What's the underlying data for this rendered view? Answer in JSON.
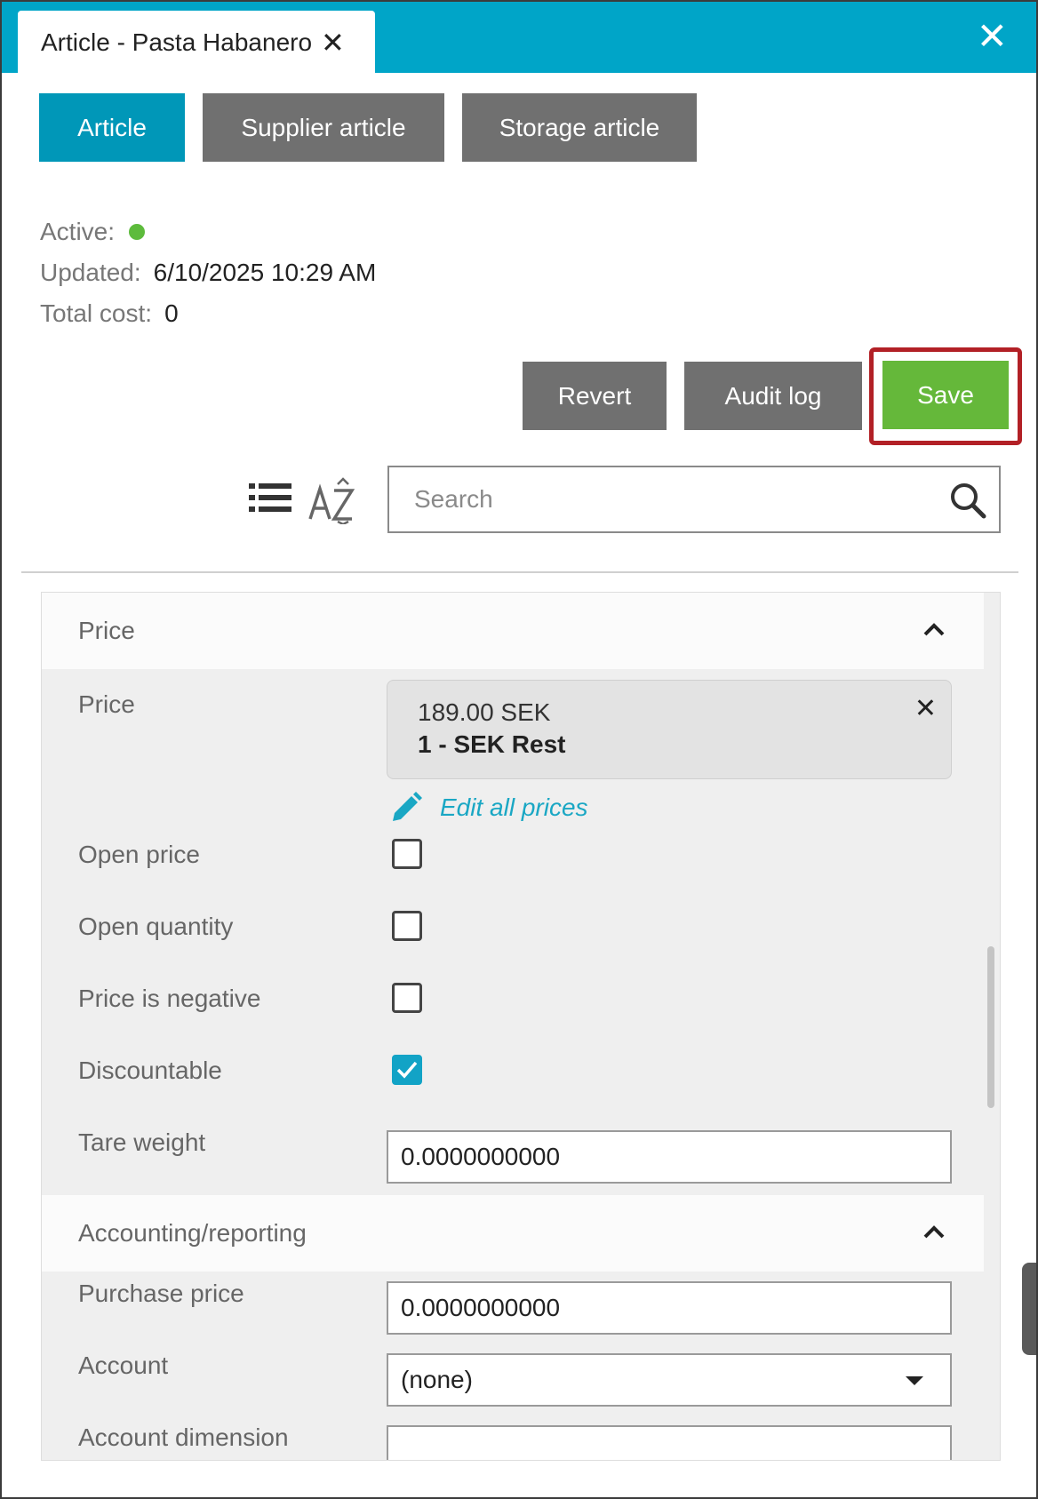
{
  "window": {
    "title": "Article - Pasta Habanero",
    "tab_close_glyph": "✕",
    "close_glyph": "✕"
  },
  "tabs": [
    {
      "label": "Article",
      "active": true
    },
    {
      "label": "Supplier article",
      "active": false
    },
    {
      "label": "Storage article",
      "active": false
    }
  ],
  "info": {
    "active_label": "Active:",
    "active_status_color": "#5dbb3c",
    "updated_label": "Updated:",
    "updated_value": "6/10/2025 10:29 AM",
    "total_cost_label": "Total cost:",
    "total_cost_value": "0"
  },
  "actions": {
    "revert_label": "Revert",
    "audit_log_label": "Audit log",
    "save_label": "Save"
  },
  "toolbar": {
    "list_view_icon": "list-icon",
    "sort_icon": "sort-az-icon",
    "search_placeholder": "Search",
    "search_value": ""
  },
  "sections": {
    "price": {
      "title": "Price",
      "price_label": "Price",
      "price_amount": "189.00 SEK",
      "price_level": "1 - SEK Rest",
      "remove_glyph": "✕",
      "edit_all_prices_label": "Edit all prices",
      "open_price_label": "Open price",
      "open_price_checked": false,
      "open_quantity_label": "Open quantity",
      "open_quantity_checked": false,
      "price_is_negative_label": "Price is negative",
      "price_is_negative_checked": false,
      "discountable_label": "Discountable",
      "discountable_checked": true,
      "tare_weight_label": "Tare weight",
      "tare_weight_value": "0.0000000000"
    },
    "accounting": {
      "title": "Accounting/reporting",
      "purchase_price_label": "Purchase price",
      "purchase_price_value": "0.0000000000",
      "account_label": "Account",
      "account_value": "(none)",
      "account_dimension_label": "Account dimension",
      "account_dimension_value": ""
    }
  },
  "colors": {
    "header_bg": "#00a5c8",
    "active_tab": "#0097b8",
    "inactive_button": "#707070",
    "save_button": "#65b83a",
    "save_highlight_border": "#b22026",
    "link": "#1aa7c4",
    "checkbox_checked": "#12a3c6"
  }
}
